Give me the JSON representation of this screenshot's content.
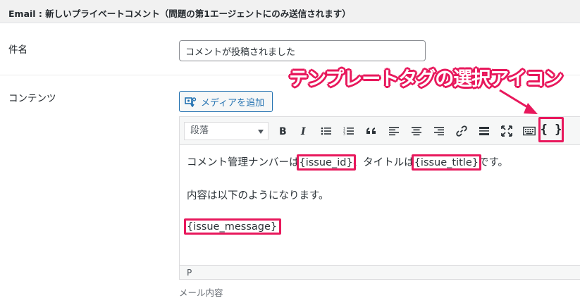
{
  "header": {
    "title": "Email : 新しいプライベートコメント（問題の第1エージェントにのみ送信されます）"
  },
  "subject": {
    "label": "件名",
    "value": "コメントが投稿されました"
  },
  "content": {
    "label": "コンテンツ",
    "media_button": "メディアを追加",
    "format_select": "段落",
    "editor_lines": {
      "line1_prefix": "コメント管理ナンバーは",
      "tag_issue_id": "{issue_id}",
      "line1_mid": "、タイトルは",
      "tag_issue_title": "{issue_title}",
      "line1_suffix": "です。",
      "line2": "内容は以下のようになります。",
      "tag_issue_message": "{issue_message}"
    },
    "status_path": "P",
    "description": "メール内容"
  },
  "annotation": {
    "callout": "テンプレートタグの選択アイコン",
    "template_tag_icon": "{ }"
  },
  "colors": {
    "accent": "#e8185c",
    "link": "#2271b1"
  }
}
